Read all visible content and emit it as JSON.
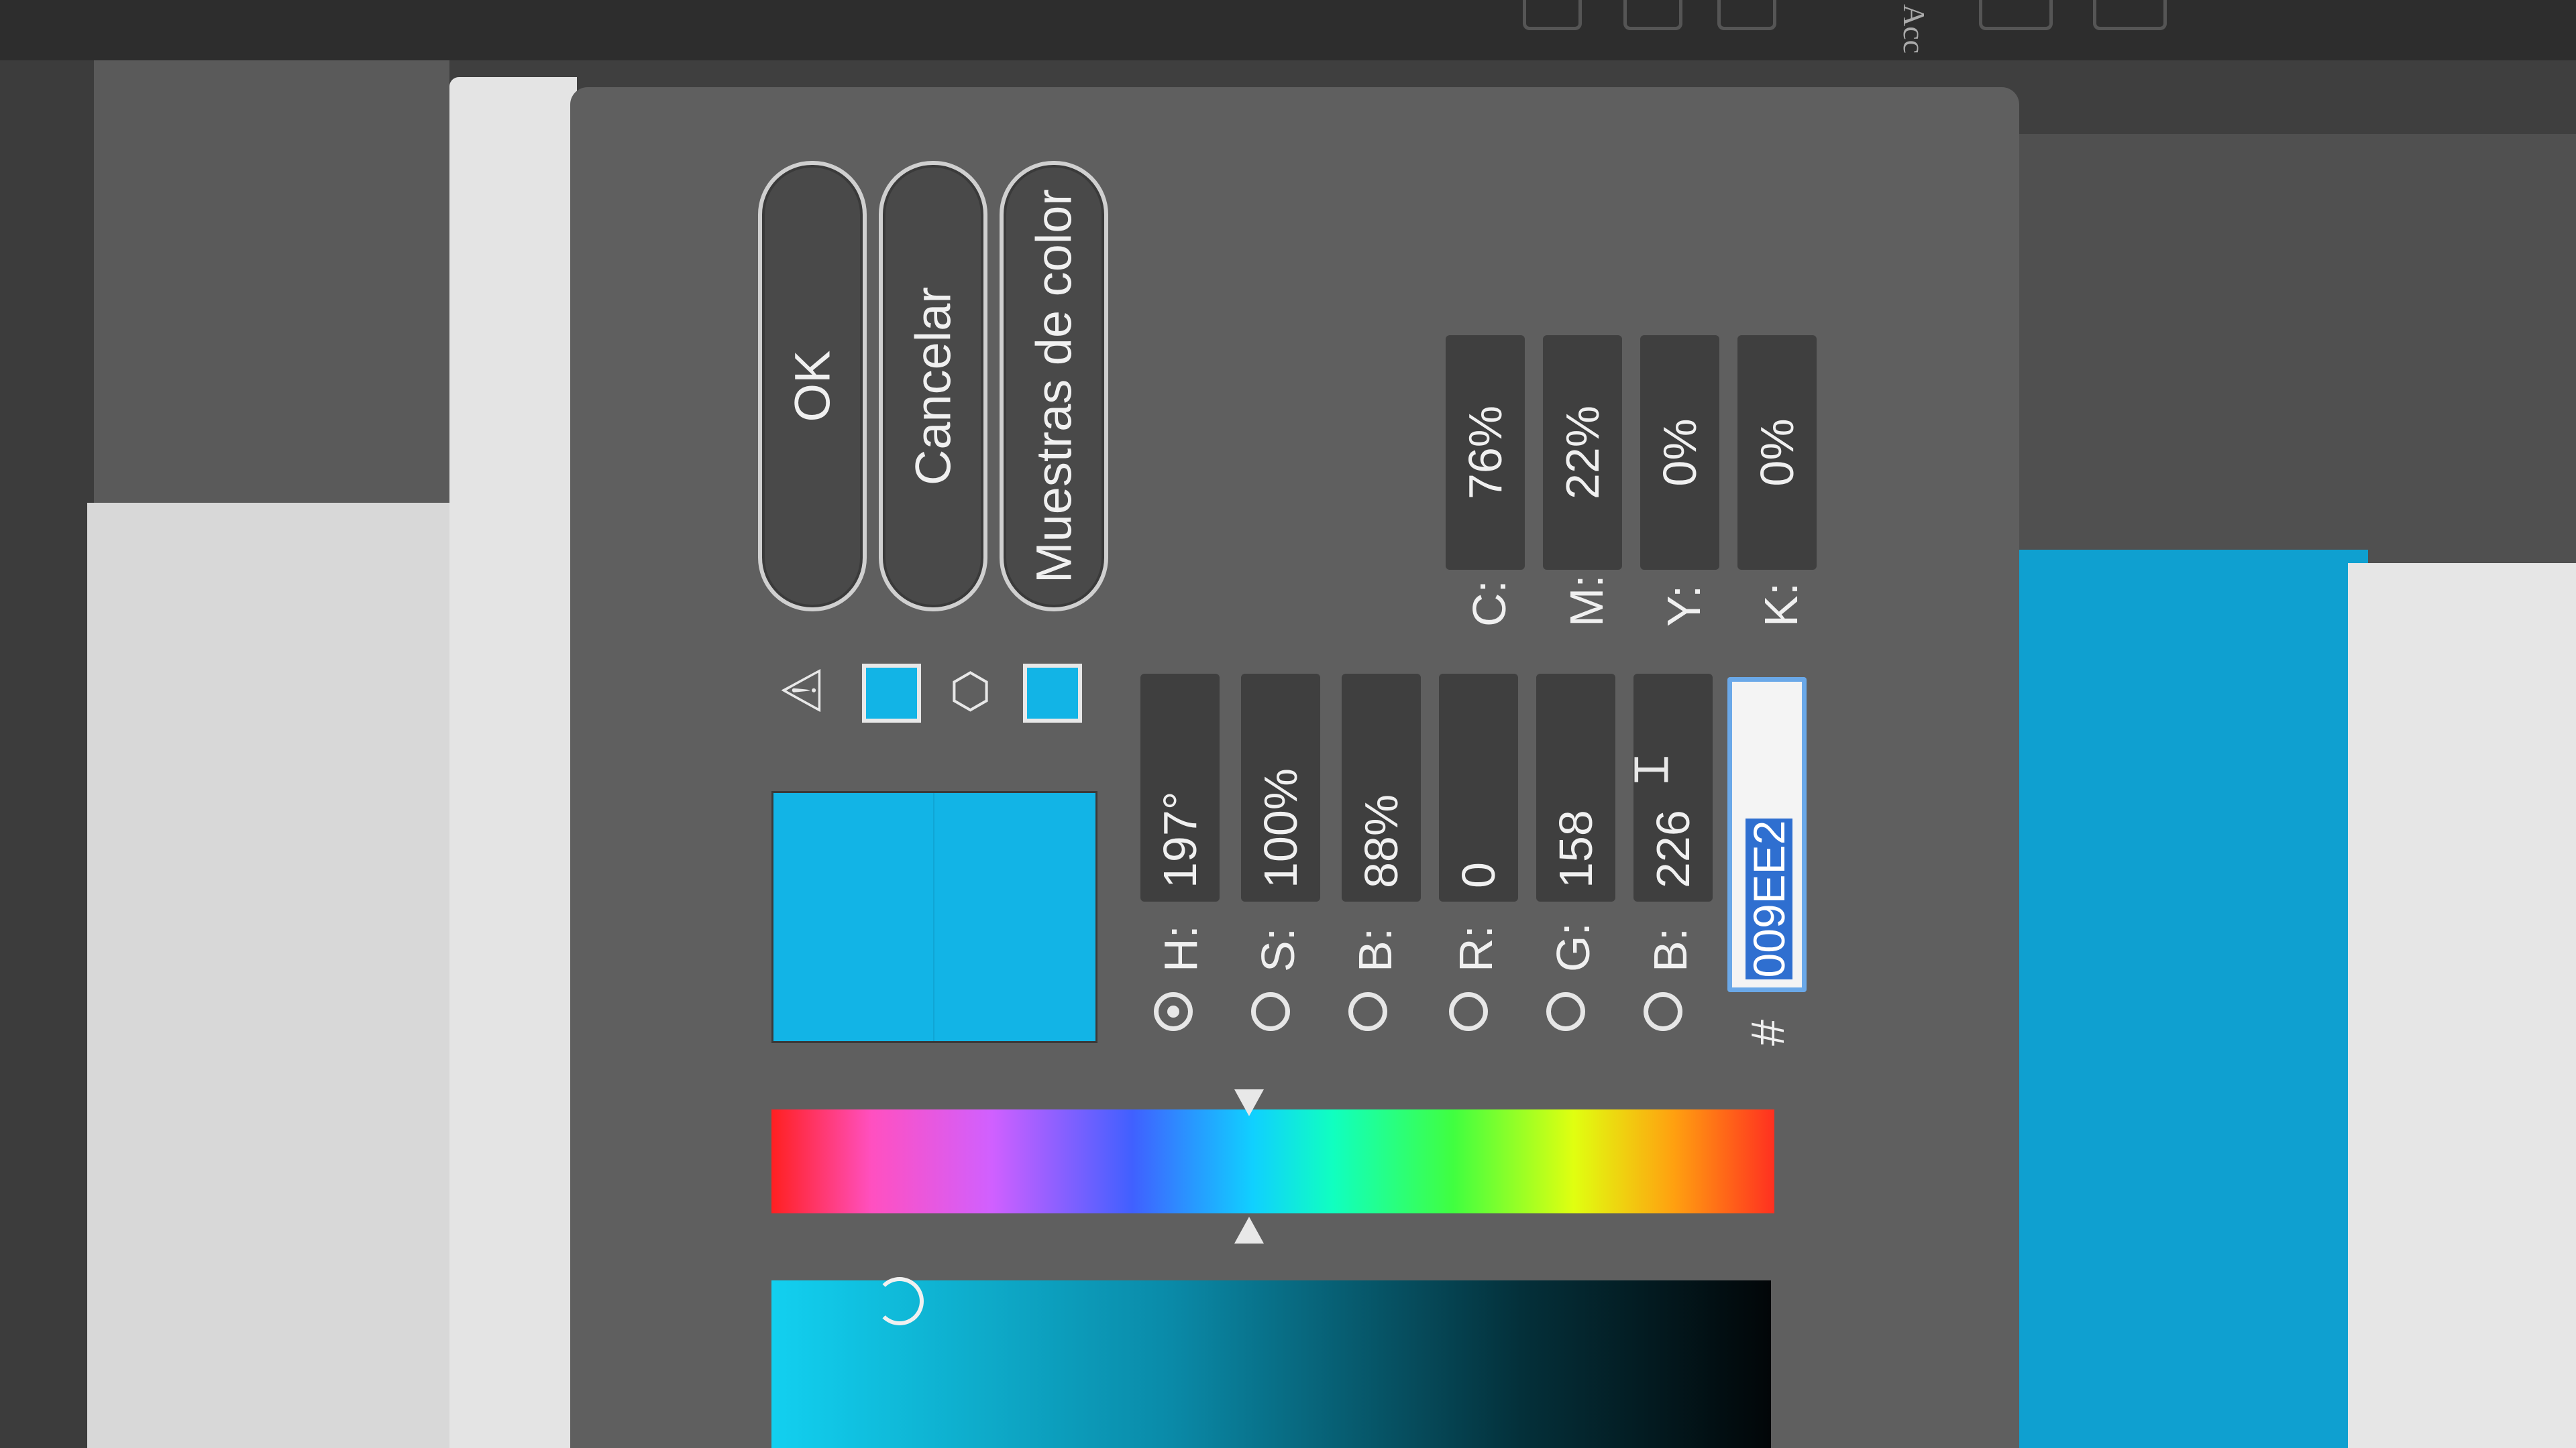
{
  "menubar": {
    "text_right": "Acc"
  },
  "buttons": {
    "ok": "OK",
    "cancel": "Cancelar",
    "swatches": "Muestras de color"
  },
  "hsb": [
    {
      "label": "H:",
      "value": "197°",
      "selected": true
    },
    {
      "label": "S:",
      "value": "100%",
      "selected": false
    },
    {
      "label": "B:",
      "value": "88%",
      "selected": false
    }
  ],
  "rgb": [
    {
      "label": "R:",
      "value": "0",
      "selected": false
    },
    {
      "label": "G:",
      "value": "158",
      "selected": false
    },
    {
      "label": "B:",
      "value": "226",
      "selected": false
    }
  ],
  "hex": {
    "label": "#",
    "value": "009EE2"
  },
  "cmyk": [
    {
      "label": "C:",
      "value": "76%"
    },
    {
      "label": "M:",
      "value": "22%"
    },
    {
      "label": "Y:",
      "value": "0%"
    },
    {
      "label": "K:",
      "value": "0%"
    }
  ],
  "colors": {
    "current": "#12b4e6",
    "selection": "#2f6fd0"
  },
  "icons": {
    "gamut_warning": "warning-triangle-icon",
    "web_safe": "cube-icon"
  }
}
